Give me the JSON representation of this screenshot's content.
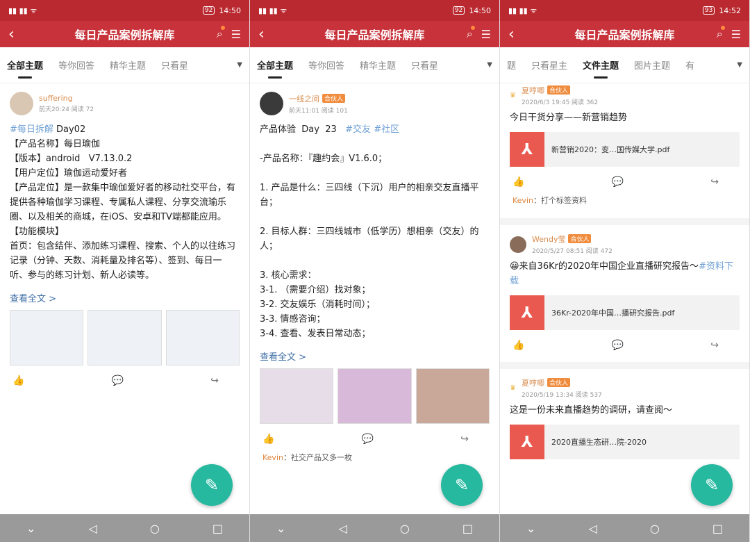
{
  "app_title": "每日产品案例拆解库",
  "panels": [
    {
      "status": {
        "time": "14:50",
        "battery": "92"
      },
      "tabs": [
        "全部主题",
        "等你回答",
        "精华主题",
        "只看星"
      ],
      "post": {
        "user": "suffering",
        "meta": "前天20:24  阅读 72",
        "tag": "#每日拆解",
        "title": " Day02",
        "body": "【产品名称】每日瑜伽\n【版本】android   V7.13.0.2\n【用户定位】瑜伽运动爱好者\n【产品定位】是一款集中瑜伽爱好者的移动社交平台，有提供各种瑜伽学习课程、专属私人课程、分享交流瑜乐圈、以及相关的商城，在iOS、安卓和TV端都能应用。\n【功能模块】\n首页：包含结伴、添加练习课程、搜索、个人的以往练习记录（分钟、天数、消耗量及排名等）、签到、每日一听、参与的练习计划、新人必读等。",
        "read_more": "查看全文 >"
      }
    },
    {
      "status": {
        "time": "14:50",
        "battery": "92"
      },
      "tabs": [
        "全部主题",
        "等你回答",
        "精华主题",
        "只看星"
      ],
      "post": {
        "user": "一线之间",
        "badge": "合伙人",
        "meta": "前天11:01  阅读 101",
        "title_line": "产品体验  Day  23",
        "tags": [
          "#交友",
          "#社区"
        ],
        "body": "-产品名称：『趣约会』V1.6.0；\n\n1. 产品是什么：三四线（下沉）用户的相亲交友直播平台；\n\n2. 目标人群：三四线城市（低学历）想相亲（交友）的人；\n\n3. 核心需求：\n3-1. （需要介绍）找对象；\n3-2. 交友娱乐（消耗时间）；\n3-3. 情感咨询；\n3-4. 查看、发表日常动态；",
        "read_more": "查看全文 >",
        "comment_user": "Kevin",
        "comment_text": "：社交产品又多一枚"
      }
    },
    {
      "status": {
        "time": "14:52",
        "battery": "93"
      },
      "tabs": [
        "题",
        "只看星主",
        "文件主题",
        "图片主题",
        "有"
      ],
      "posts": [
        {
          "user": "夏哼唧",
          "badge": "合伙人",
          "meta": "2020/6/3 19:45  阅读 362",
          "text": "今日干货分享——新营销趋势",
          "file": "新营销2020：变…国传媒大学.pdf",
          "comment_user": "Kevin",
          "comment_text": "：打个标签资料"
        },
        {
          "user": "Wendy莹",
          "badge": "合伙人",
          "meta": "2020/5/27 08:51  阅读 472",
          "text": "😀来自36Kr的2020年中国企业直播研究报告～",
          "tag": "#资料下载",
          "file": "36Kr-2020年中国…播研究报告.pdf"
        },
        {
          "user": "夏哼唧",
          "badge": "合伙人",
          "meta": "2020/5/19 13:34  阅读 537",
          "text": "这是一份未来直播趋势的调研，请查阅～",
          "file": "2020直播生态研…院-2020"
        }
      ]
    }
  ]
}
